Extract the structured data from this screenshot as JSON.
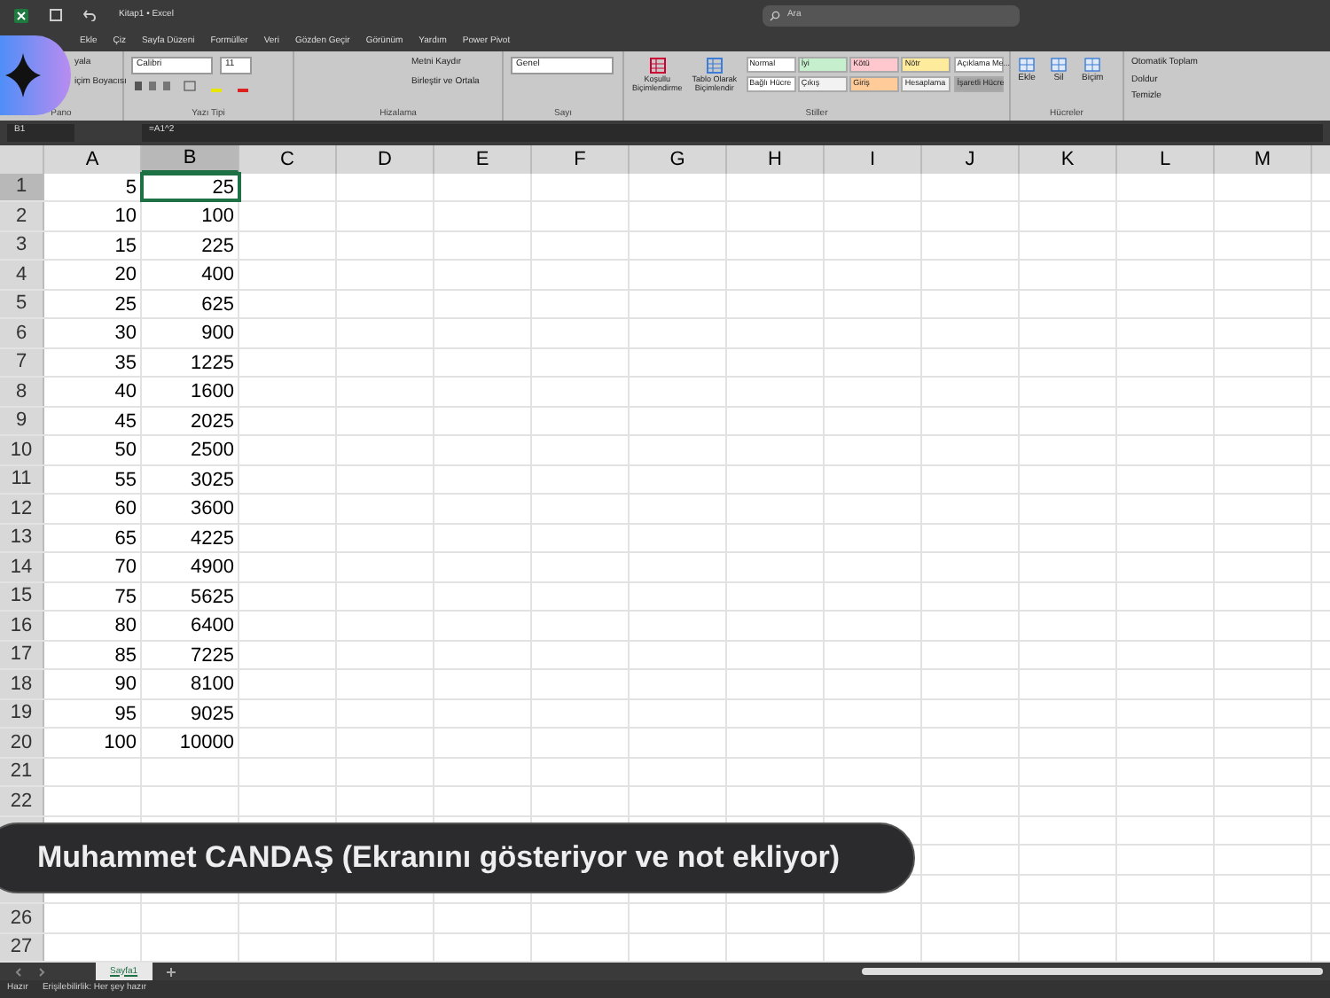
{
  "window": {
    "title": "Kitap1 • Excel",
    "search": {
      "placeholder": "Ara"
    }
  },
  "menu_tabs": [
    {
      "label": "Ekle",
      "selected": false
    },
    {
      "label": "Çiz",
      "selected": false
    },
    {
      "label": "Sayfa Düzeni",
      "selected": false
    },
    {
      "label": "Formüller",
      "selected": false
    },
    {
      "label": "Veri",
      "selected": false
    },
    {
      "label": "Gözden Geçir",
      "selected": false
    },
    {
      "label": "Görünüm",
      "selected": false
    },
    {
      "label": "Yardım",
      "selected": false
    },
    {
      "label": "Power Pivot",
      "selected": false
    }
  ],
  "ribbon": {
    "clipboard": {
      "items": [
        "yala",
        "içim Boyacısı"
      ],
      "group": "Pano"
    },
    "font": {
      "name": "Calibri",
      "size": "11",
      "group": "Yazı Tipi"
    },
    "alignment": {
      "items": [
        "Metni Kaydır",
        "Birleştir ve Ortala"
      ],
      "group": "Hizalama"
    },
    "number": {
      "format": "Genel",
      "group": "Sayı"
    },
    "styles": {
      "buttons": [
        "Koşullu Biçimlendirme",
        "Tablo Olarak Biçimlendir"
      ],
      "cells": [
        {
          "label": "Normal",
          "color": "#ffffff"
        },
        {
          "label": "İyi",
          "color": "#c6efce"
        },
        {
          "label": "Kötü",
          "color": "#ffc7ce"
        },
        {
          "label": "Nötr",
          "color": "#ffeb9c"
        },
        {
          "label": "Açıklama Me...",
          "color": "#ffffff"
        },
        {
          "label": "Bağlı Hücre",
          "color": "#ffffff"
        },
        {
          "label": "Çıkış",
          "color": "#f2f2f2"
        },
        {
          "label": "Giriş",
          "color": "#ffcc99"
        },
        {
          "label": "Hesaplama",
          "color": "#f2f2f2"
        },
        {
          "label": "İşaretli Hücre",
          "color": "#a5a5a5"
        }
      ],
      "group": "Stiller"
    },
    "cells_group": {
      "buttons": [
        "Ekle",
        "Sil",
        "Biçim"
      ],
      "group": "Hücreler"
    },
    "editing": {
      "items": [
        "Otomatik Toplam",
        "Doldur",
        "Temizle"
      ]
    }
  },
  "formula_bar": {
    "name_box": "B1",
    "formula": "=A1^2"
  },
  "columns": [
    {
      "label": "A",
      "selected": false
    },
    {
      "label": "B",
      "selected": true
    },
    {
      "label": "C",
      "selected": false
    },
    {
      "label": "D",
      "selected": false
    },
    {
      "label": "E",
      "selected": false
    },
    {
      "label": "F",
      "selected": false
    },
    {
      "label": "G",
      "selected": false
    },
    {
      "label": "H",
      "selected": false
    },
    {
      "label": "I",
      "selected": false
    },
    {
      "label": "J",
      "selected": false
    },
    {
      "label": "K",
      "selected": false
    },
    {
      "label": "L",
      "selected": false
    },
    {
      "label": "M",
      "selected": false
    }
  ],
  "rows": [
    {
      "label": "1",
      "cells": [
        "5",
        "25"
      ],
      "selected": true
    },
    {
      "label": "2",
      "cells": [
        "10",
        "100"
      ],
      "selected": false
    },
    {
      "label": "3",
      "cells": [
        "15",
        "225"
      ],
      "selected": false
    },
    {
      "label": "4",
      "cells": [
        "20",
        "400"
      ],
      "selected": false
    },
    {
      "label": "5",
      "cells": [
        "25",
        "625"
      ],
      "selected": false
    },
    {
      "label": "6",
      "cells": [
        "30",
        "900"
      ],
      "selected": false
    },
    {
      "label": "7",
      "cells": [
        "35",
        "1225"
      ],
      "selected": false
    },
    {
      "label": "8",
      "cells": [
        "40",
        "1600"
      ],
      "selected": false
    },
    {
      "label": "9",
      "cells": [
        "45",
        "2025"
      ],
      "selected": false
    },
    {
      "label": "10",
      "cells": [
        "50",
        "2500"
      ],
      "selected": false
    },
    {
      "label": "11",
      "cells": [
        "55",
        "3025"
      ],
      "selected": false
    },
    {
      "label": "12",
      "cells": [
        "60",
        "3600"
      ],
      "selected": false
    },
    {
      "label": "13",
      "cells": [
        "65",
        "4225"
      ],
      "selected": false
    },
    {
      "label": "14",
      "cells": [
        "70",
        "4900"
      ],
      "selected": false
    },
    {
      "label": "15",
      "cells": [
        "75",
        "5625"
      ],
      "selected": false
    },
    {
      "label": "16",
      "cells": [
        "80",
        "6400"
      ],
      "selected": false
    },
    {
      "label": "17",
      "cells": [
        "85",
        "7225"
      ],
      "selected": false
    },
    {
      "label": "18",
      "cells": [
        "90",
        "8100"
      ],
      "selected": false
    },
    {
      "label": "19",
      "cells": [
        "95",
        "9025"
      ],
      "selected": false
    },
    {
      "label": "20",
      "cells": [
        "100",
        "10000"
      ],
      "selected": false
    },
    {
      "label": "21",
      "selected": false
    },
    {
      "label": "22",
      "selected": false
    },
    {},
    {},
    {},
    {
      "label": "26",
      "selected": false
    },
    {
      "label": "27",
      "selected": false
    }
  ],
  "sheet_tabs": [
    {
      "label": "Sayfa1",
      "selected": true
    }
  ],
  "status_bar": {
    "state": "Hazır",
    "accessibility": "Erişilebilirlik: Her şey hazır"
  },
  "banner": {
    "text": "Muhammet CANDAŞ (Ekranını gösteriyor ve not ekliyor)"
  }
}
